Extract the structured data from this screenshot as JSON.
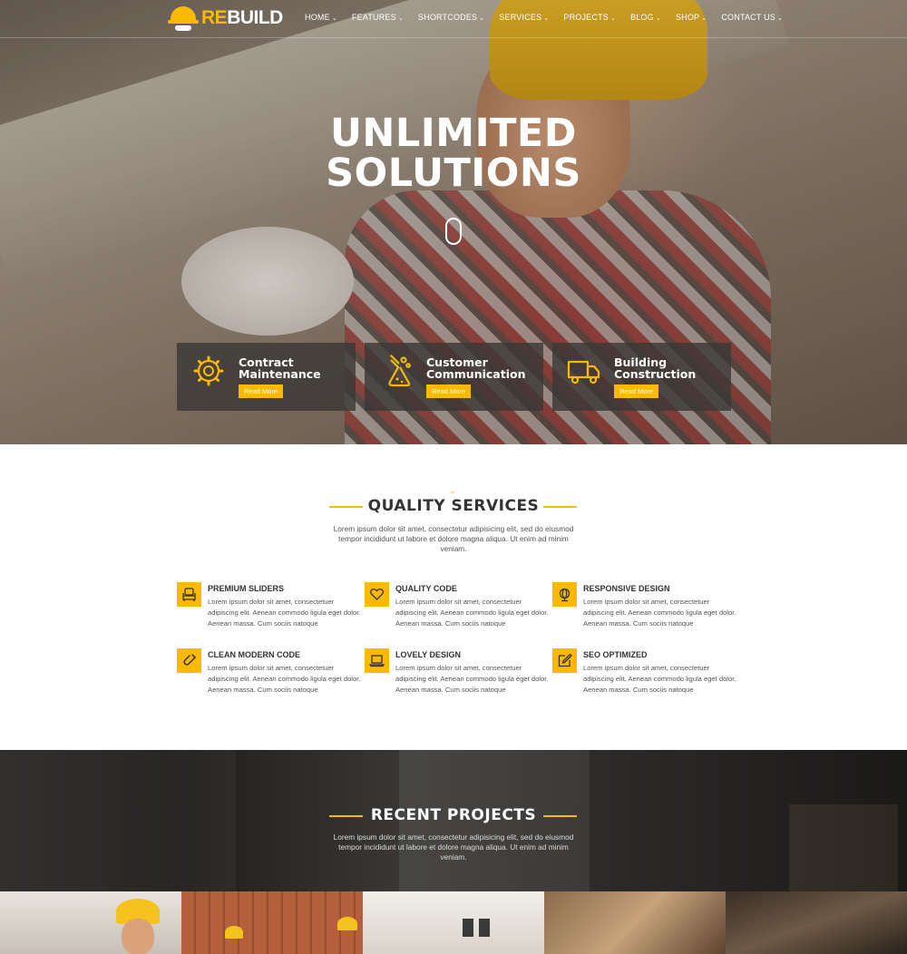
{
  "brand": {
    "logo_prefix": "RE",
    "logo_suffix": "BUILD",
    "accent": "#fbb900"
  },
  "nav": {
    "items": [
      {
        "label": "HOME",
        "icon": "chevron-down-icon"
      },
      {
        "label": "FEATURES",
        "icon": "chevron-down-icon"
      },
      {
        "label": "SHORTCODES",
        "icon": "chevron-down-icon"
      },
      {
        "label": "SERVICES",
        "icon": "chevron-down-icon"
      },
      {
        "label": "PROJECTS",
        "icon": "chevron-down-icon"
      },
      {
        "label": "BLOG",
        "icon": "chevron-down-icon"
      },
      {
        "label": "SHOP",
        "icon": "chevron-down-icon"
      },
      {
        "label": "CONTACT US",
        "icon": "chevron-down-icon"
      }
    ]
  },
  "hero": {
    "title_line1": "UNLIMITED",
    "title_line2": "SOLUTIONS",
    "features": [
      {
        "title_line1": "Contract",
        "title_line2": "Maintenance",
        "button": "Read More",
        "icon": "gear-icon"
      },
      {
        "title_line1": "Customer",
        "title_line2": "Communication",
        "button": "Read More",
        "icon": "flask-icon"
      },
      {
        "title_line1": "Building",
        "title_line2": "Construction",
        "button": "Read More",
        "icon": "truck-icon"
      }
    ]
  },
  "quality": {
    "title": "QUALITY SERVICES",
    "description": "Lorem ipsum dolor sit amet, consectetur adipisicing elit, sed do eiusmod tempor incididunt ut labore et dolore magna aliqua. Ut enim ad minim veniam.",
    "services": [
      {
        "title": "PREMIUM SLIDERS",
        "text": "Lorem ipsum dolor sit amet, consectetuer adipiscing elit. Aenean commodo ligula eget dolor. Aenean massa. Cum sociis natoque",
        "icon": "couch-icon"
      },
      {
        "title": "QUALITY CODE",
        "text": "Lorem ipsum dolor sit amet, consectetuer adipiscing elit. Aenean commodo ligula eget dolor. Aenean massa. Cum sociis natoque",
        "icon": "heart-icon"
      },
      {
        "title": "RESPONSIVE DESIGN",
        "text": "Lorem ipsum dolor sit amet, consectetuer adipiscing elit. Aenean commodo ligula eget dolor. Aenean massa. Cum sociis natoque",
        "icon": "globe-icon"
      },
      {
        "title": "CLEAN MODERN CODE",
        "text": "Lorem ipsum dolor sit amet, consectetuer adipiscing elit. Aenean commodo ligula eget dolor. Aenean massa. Cum sociis natoque",
        "icon": "magnet-icon"
      },
      {
        "title": "LOVELY DESIGN",
        "text": "Lorem ipsum dolor sit amet, consectetuer adipiscing elit. Aenean commodo ligula eget dolor. Aenean massa. Cum sociis natoque",
        "icon": "laptop-icon"
      },
      {
        "title": "SEO OPTIMIZED",
        "text": "Lorem ipsum dolor sit amet, consectetuer adipiscing elit. Aenean commodo ligula eget dolor. Aenean massa. Cum sociis natoque",
        "icon": "edit-icon"
      }
    ]
  },
  "projects": {
    "title": "RECENT PROJECTS",
    "description": "Lorem ipsum dolor sit amet, consectetur adipisicing elit, sed do eiusmod tempor incididunt ut labore et dolore magna aliqua. Ut enim ad minim veniam."
  }
}
